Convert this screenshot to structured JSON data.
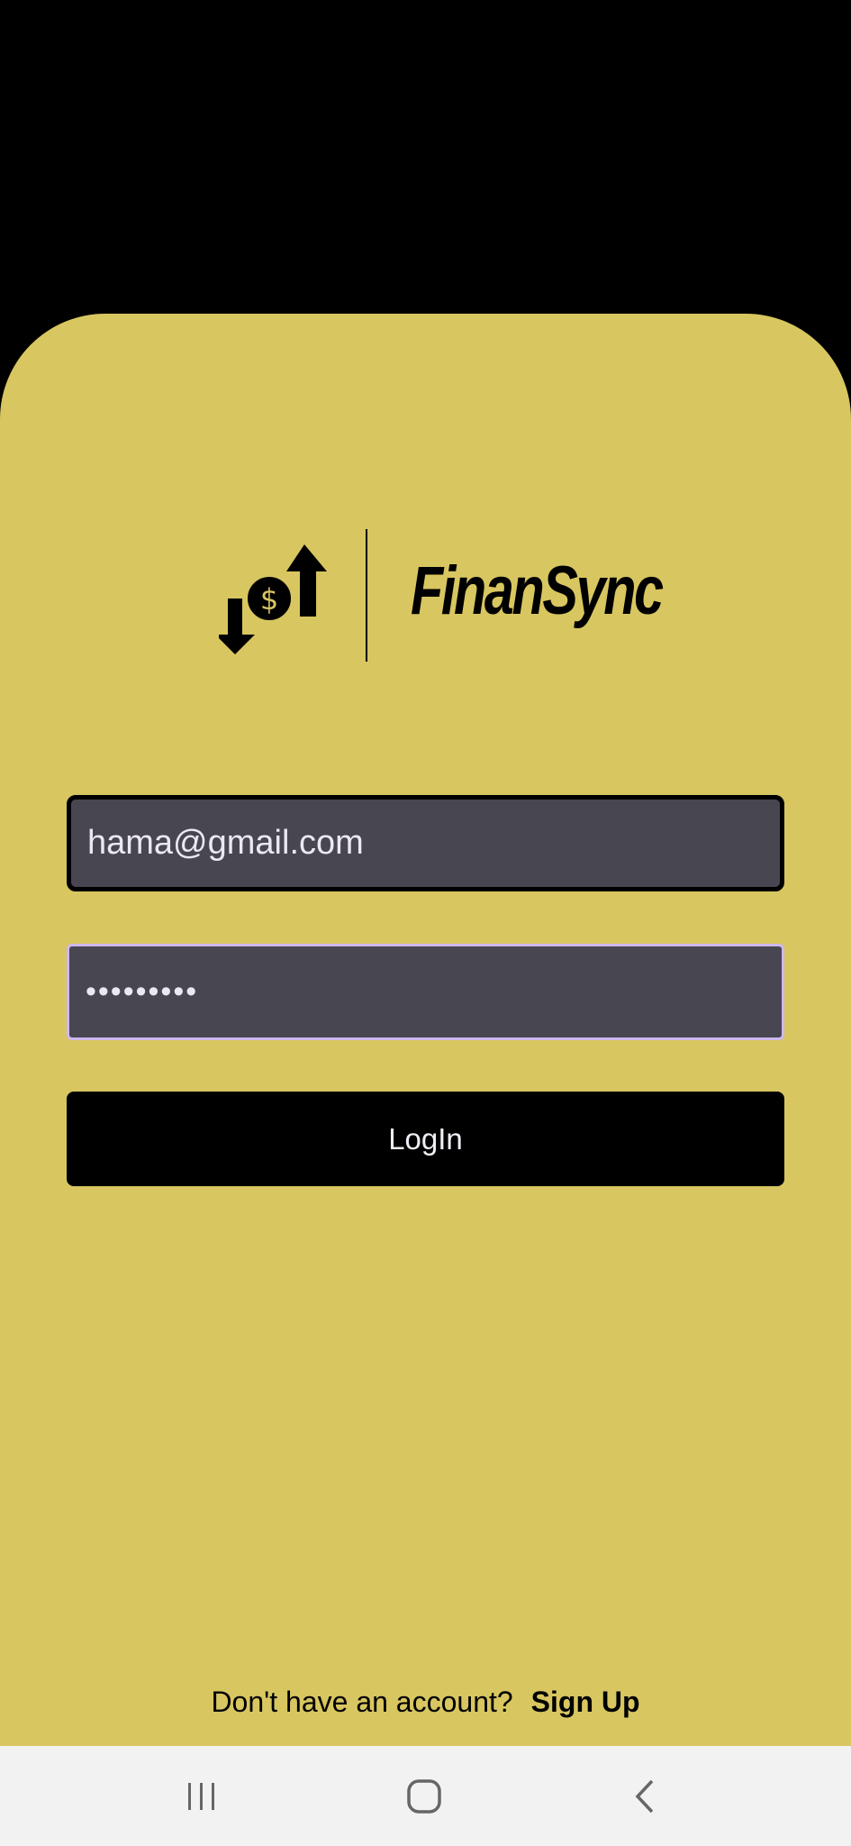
{
  "app": {
    "brand_name": "FinanSync",
    "accent_color": "#d8c660"
  },
  "login_form": {
    "email_value": "hama@gmail.com",
    "password_value": "•••••••••",
    "login_label": "LogIn"
  },
  "footer": {
    "prompt": "Don't have an account?",
    "signup_label": "Sign Up"
  },
  "navbar": {
    "icons": [
      "recent-apps-icon",
      "home-icon",
      "back-icon"
    ]
  }
}
